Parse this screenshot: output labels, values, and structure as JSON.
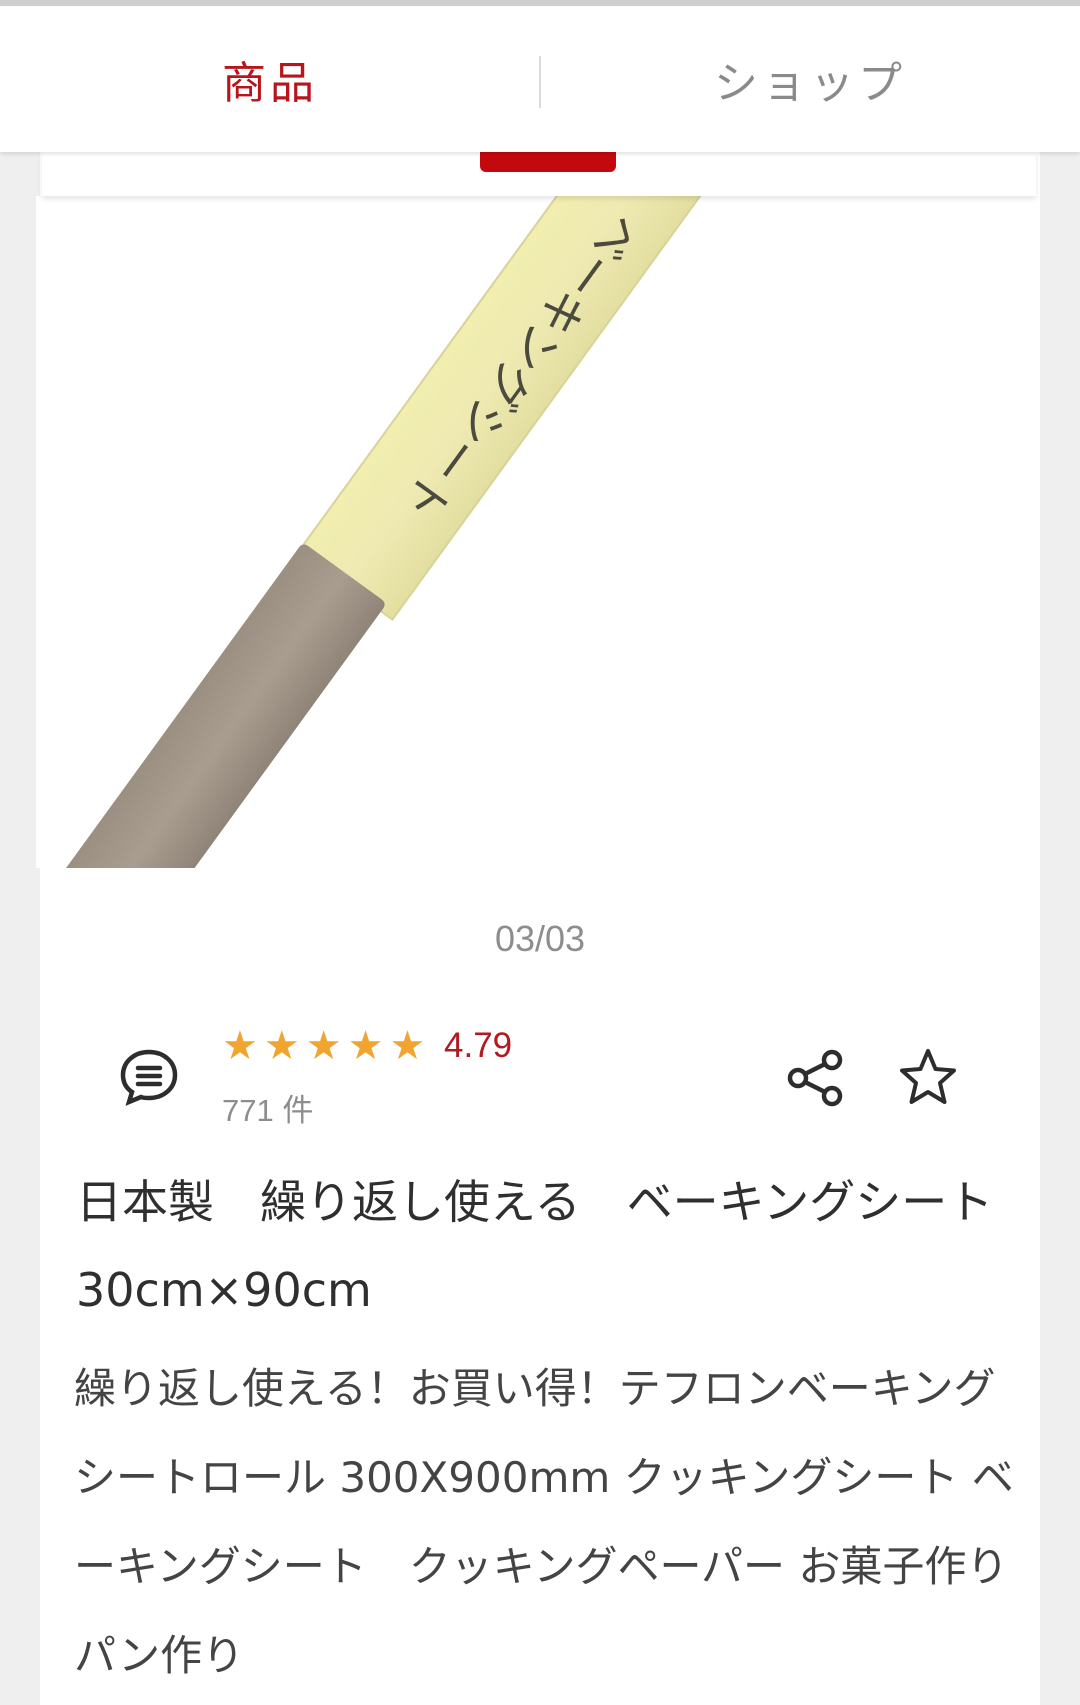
{
  "tabs": {
    "products_label": "商品",
    "shop_label": "ショップ",
    "active": "products"
  },
  "gallery": {
    "counter": "03/03",
    "image_text": "ベーキングシート"
  },
  "rating": {
    "value": "4.79",
    "stars": 5,
    "count": "771 件"
  },
  "icons": {
    "comments": "comment-icon",
    "share": "share-icon",
    "favorite": "star-outline-icon"
  },
  "product": {
    "title": "日本製　繰り返し使える　ベーキングシート　30cm×90cm",
    "description": "繰り返し使える！お買い得！テフロンベーキングシートロール 300X900mm クッキングシート ベーキングシート　クッキングペーパー お菓子作り パン作り"
  },
  "colors": {
    "accent": "#b8141c",
    "star": "#f0a531",
    "muted": "#8d8d8d"
  }
}
